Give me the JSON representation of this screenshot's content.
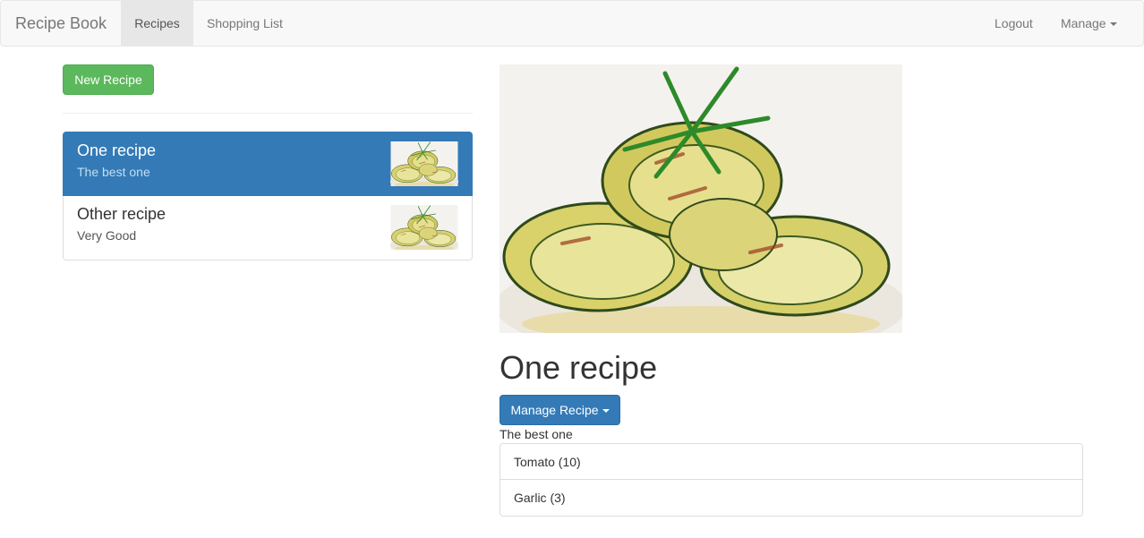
{
  "navbar": {
    "brand": "Recipe Book",
    "links": [
      "Recipes",
      "Shopping List"
    ],
    "right": {
      "logout": "Logout",
      "manage": "Manage"
    }
  },
  "sidebar": {
    "new_button": "New Recipe",
    "recipes": [
      {
        "name": "One recipe",
        "description": "The best one",
        "active": true
      },
      {
        "name": "Other recipe",
        "description": "Very Good",
        "active": false
      }
    ]
  },
  "detail": {
    "image": "food-photo zucchini rolls with rosemary",
    "title": "One recipe",
    "manage_button": "Manage Recipe",
    "description": "The best one",
    "ingredients": [
      "Tomato (10)",
      "Garlic (3)"
    ]
  },
  "colors": {
    "primary": "#337ab7",
    "success": "#5cb85c",
    "navbar_bg": "#f8f8f8"
  }
}
